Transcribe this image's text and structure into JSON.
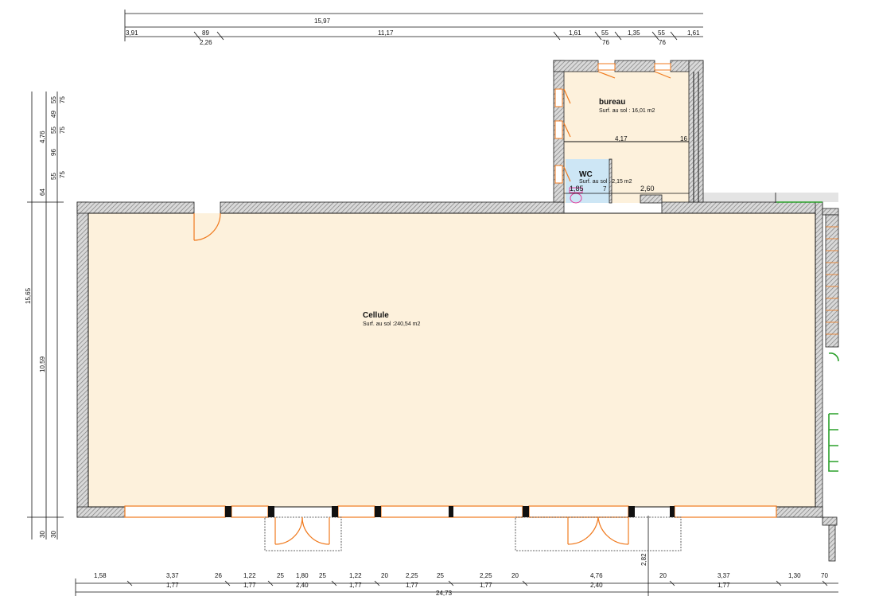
{
  "top_dimensions": {
    "overall": "15,97",
    "chain": [
      "3,91",
      "89",
      "11,17",
      "1,61",
      "55",
      "1,35",
      "55",
      "1,61"
    ],
    "sub": [
      "2,26",
      "76",
      "76"
    ]
  },
  "left_dimensions": {
    "overall": "15,65",
    "main": "10,59",
    "col1": [
      "4,76",
      "64",
      "30"
    ],
    "col2": [
      "55",
      "49",
      "55",
      "96",
      "55",
      "30"
    ],
    "col3": [
      "75",
      "75",
      "75"
    ]
  },
  "bottom_dimensions": {
    "overall": "24,73",
    "upper": [
      "1,58",
      "3,37",
      "26",
      "1,22",
      "25",
      "1,80",
      "25",
      "1,22",
      "20",
      "2,25",
      "25",
      "2,25",
      "20",
      "4,76",
      "20",
      "3,37",
      "1,30",
      "70"
    ],
    "lower": [
      "1,77",
      "1,77",
      "2,40",
      "1,77",
      "1,77",
      "1,77",
      "2,40",
      "1,77"
    ],
    "vertical": "2,82"
  },
  "rooms": {
    "cellule": {
      "name": "Cellule",
      "surface": "Surf. au sol :240,54 m2"
    },
    "bureau": {
      "name": "bureau",
      "surface": "Surf. au sol : 16,01 m2"
    },
    "wc": {
      "name": "WC",
      "surface": "Surf. au sol : 2,15 m2"
    }
  },
  "interior_dimensions": {
    "bureau_width": "4,17",
    "bureau_partition": "16",
    "wc_width": "1,85",
    "wc_partition": "7",
    "door_width": "2,60"
  },
  "colors": {
    "floor": "#fdf1dc",
    "wc_floor": "#cde6f5",
    "wall": "#bdbdbd",
    "door": "#f07a1e",
    "neighbor": "#2aa02a",
    "line": "#111111"
  }
}
